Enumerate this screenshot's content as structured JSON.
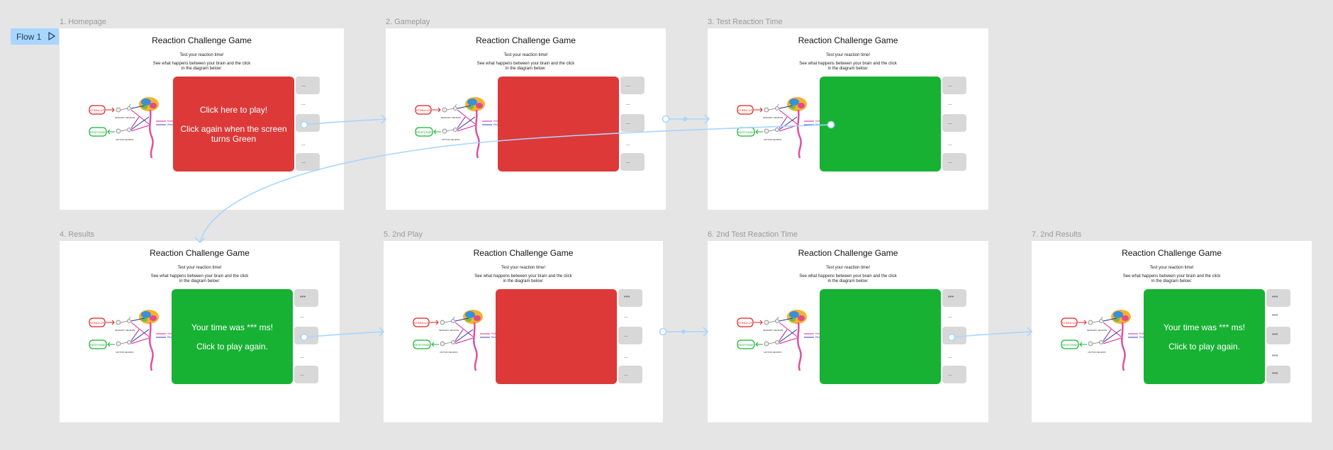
{
  "flow": {
    "label": "Flow 1"
  },
  "app": {
    "title": "Reaction Challenge Game",
    "subtitle": "Test your reaction time!",
    "description_line1": "See what happens between your brain and the click",
    "description_line2": "in the diagram below:"
  },
  "diagram": {
    "stimulus": "STIMULUS",
    "response": "RESPONSE",
    "sensory": "SENSORY NEURON",
    "motor": "MOTOR NEURON",
    "reflex": "Reflex",
    "reaction": "Reaction"
  },
  "frames": [
    {
      "label": "1. Homepage",
      "panel": "red",
      "lines": [
        "Click here to play!",
        "Click again when the screen turns Green"
      ],
      "side_top": "...",
      "side_mid": "..."
    },
    {
      "label": "2. Gameplay",
      "panel": "red",
      "lines": [],
      "side_top": "...",
      "side_mid": "..."
    },
    {
      "label": "3. Test Reaction Time",
      "panel": "green",
      "lines": [],
      "side_top": "...",
      "side_mid": "..."
    },
    {
      "label": "4. Results",
      "panel": "green",
      "lines": [
        "Your time was *** ms!",
        "Click to play again."
      ],
      "side_top": "***",
      "side_mid": "..."
    },
    {
      "label": "5. 2nd Play",
      "panel": "red",
      "lines": [],
      "side_top": "***",
      "side_mid": "..."
    },
    {
      "label": "6. 2nd Test Reaction Time",
      "panel": "green",
      "lines": [],
      "side_top": "***",
      "side_mid": "..."
    },
    {
      "label": "7. 2nd Results",
      "panel": "green",
      "lines": [
        "Your time was *** ms!",
        "Click to play again."
      ],
      "side_top": "***",
      "side_mid": "***"
    }
  ],
  "colors": {
    "red": "#dd3939",
    "green": "#17b233",
    "connector": "#a8d6ff",
    "canvas": "#e5e5e5"
  }
}
